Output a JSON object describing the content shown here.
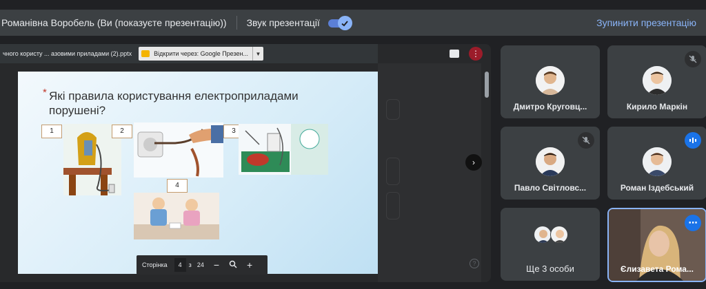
{
  "topbar": {
    "presenter_label": "Романівна Воробель (Ви (показуєте презентацію))",
    "sound_label": "Звук презентації",
    "sound_enabled": true,
    "stop_label": "Зупинити презентацію"
  },
  "viewer": {
    "file_name": "чного користу ... азовими приладами (2).pptx",
    "open_with": "Відкрити через: Google Презен..."
  },
  "slide": {
    "question": "Які правила користування електроприладами порушені?",
    "picture_numbers": [
      "1",
      "2",
      "3",
      "4"
    ]
  },
  "pager": {
    "label": "Сторінка",
    "current": "4",
    "of": "з",
    "total": "24"
  },
  "participants": [
    {
      "name": "Дмитро Круговц...",
      "muted": false
    },
    {
      "name": "Кирило Маркін",
      "muted": true
    },
    {
      "name": "Павло Світловс...",
      "muted": true
    },
    {
      "name": "Роман Іздебський",
      "muted": false,
      "speaking": true
    },
    {
      "name": "Ще 3 особи",
      "muted": false
    },
    {
      "name": "Єлизавета Рома...",
      "muted": false,
      "active": true
    }
  ],
  "colors": {
    "accent": "#8ab4f8",
    "tile_bg": "#3c4043",
    "page_bg": "#202124"
  }
}
